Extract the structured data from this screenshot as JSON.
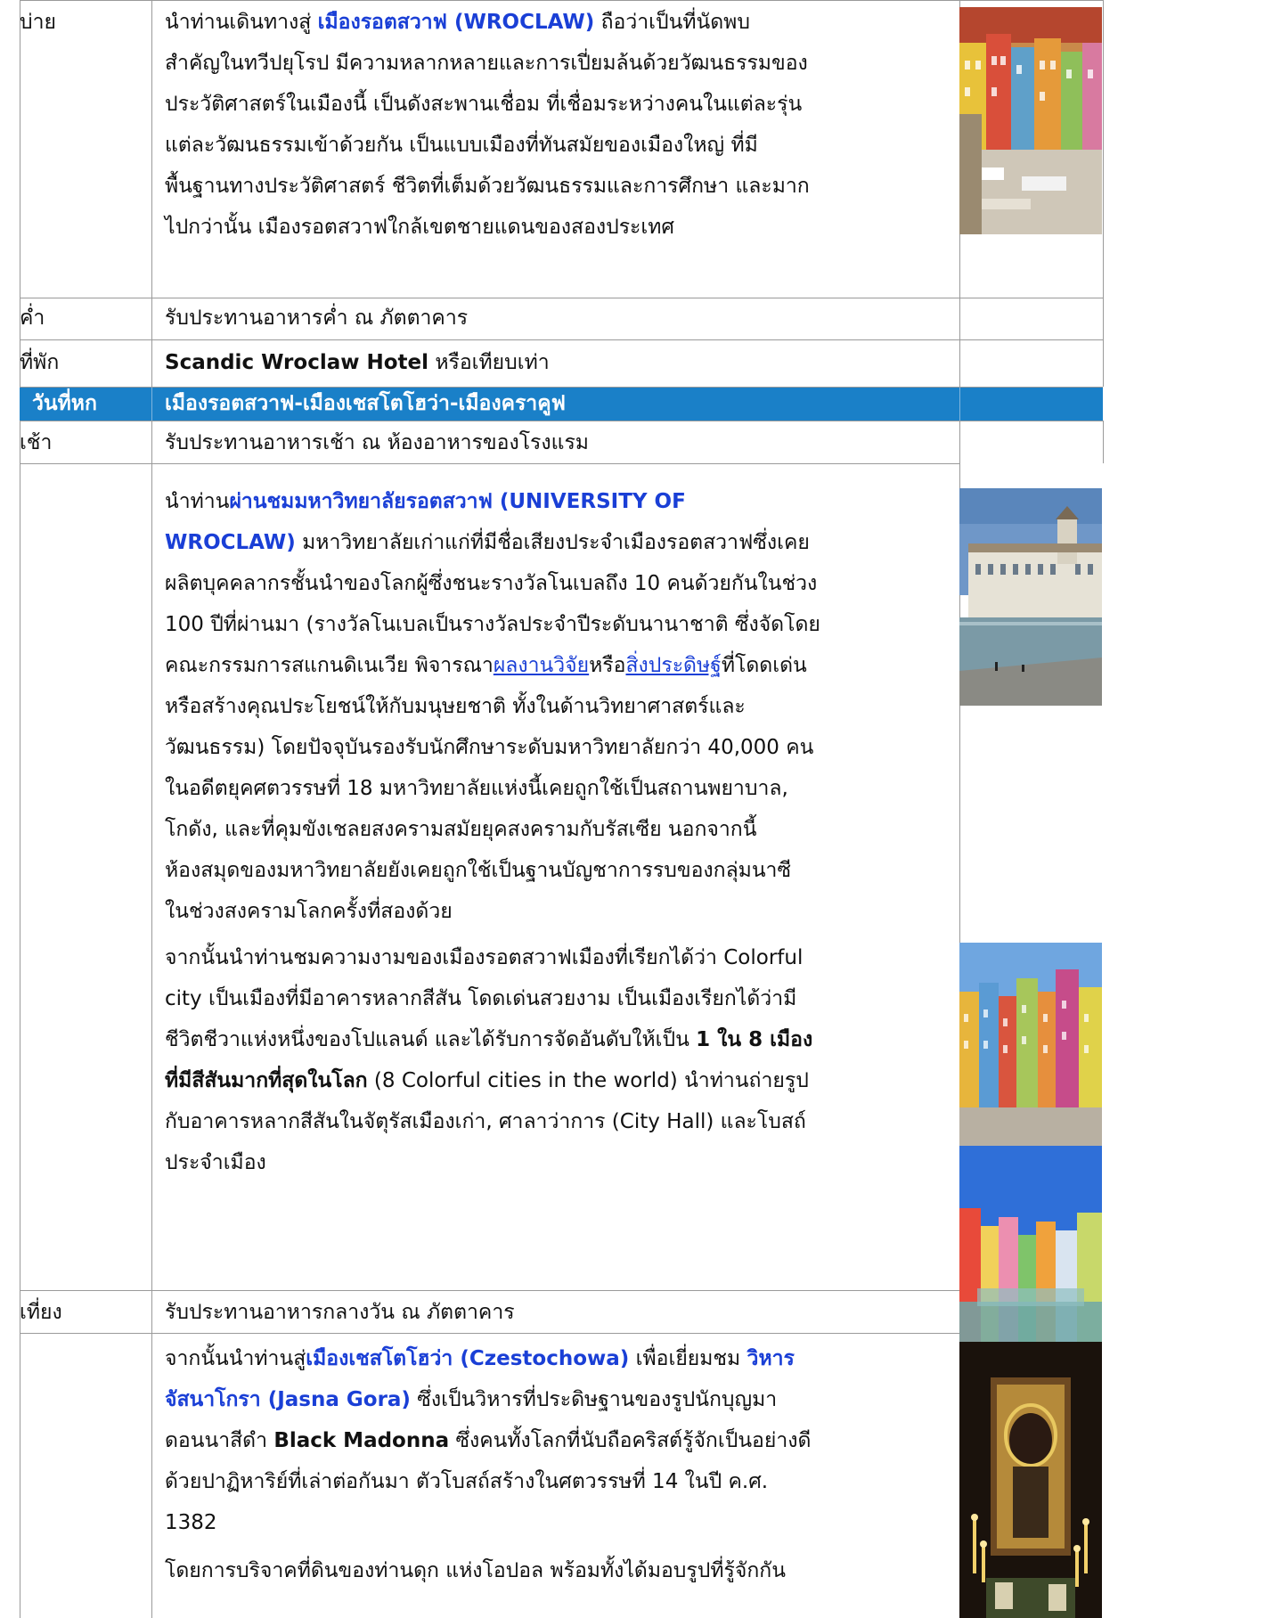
{
  "rows": {
    "afternoon": {
      "label": "บ่าย",
      "lines": [
        {
          "a": "นำท่านเดินทางสู่ ",
          "b": "เมืองรอตสวาฟ    (WROCLAW)",
          "c": " ถือว่าเป็นที่นัดพบ"
        },
        "สำคัญในทวีปยุโรป มีความหลากหลายและการเปี่ยมล้นด้วยวัฒนธรรมของ",
        "ประวัติศาสตร์ในเมืองนี้ เป็นดังสะพานเชื่อม ที่เชื่อมระหว่างคนในแต่ละรุ่น",
        "แต่ละวัฒนธรรมเข้าด้วยกัน เป็นแบบเมืองที่ทันสมัยของเมืองใหญ่ ที่มี",
        "พื้นฐานทางประวัติศาสตร์ ชีวิตที่เต็มด้วยวัฒนธรรมและการศึกษา และมาก",
        "ไปกว่านั้น เมืองรอตสวาฟใกล้เขตชายแดนของสองประเทศ"
      ]
    },
    "dinner": {
      "label": "ค่ำ",
      "text": "รับประทานอาหารค่ำ ณ ภัตตาคาร"
    },
    "hotel": {
      "label": "ที่พัก",
      "name": "Scandic Wroclaw Hotel",
      "suffix": " หรือเทียบเท่า"
    },
    "day": {
      "label": "วันที่หก",
      "title": "เมืองรอตสวาฟ-เมืองเชสโตโฮว่า-เมืองคราคูฟ"
    },
    "breakfast": {
      "label": "เช้า",
      "text": "รับประทานอาหารเช้า ณ ห้องอาหารของโรงแรม"
    },
    "university": {
      "l1a": "นำท่าน",
      "l1b": "ผ่านชมมหาวิทยาลัยรอตสวาฟ (UNIVERSITY OF",
      "l2a": "WROCLAW)",
      "l2b": " มหาวิทยาลัยเก่าแก่ที่มีชื่อเสียงประจำเมืองรอตสวาฟซึ่งเคย",
      "l3": "ผลิตบุคคลากรชั้นนำของโลกผู้ซึ่งชนะรางวัลโนเบลถึง 10 คนด้วยกันในช่วง",
      "l4": "100 ปีที่ผ่านมา (รางวัลโนเบลเป็นรางวัลประจำปีระดับนานาชาติ ซึ่งจัดโดย",
      "l5a": "คณะกรรมการสแกนดิเนเวีย พิจารณา",
      "l5link1": "ผลงานวิจัย",
      "l5b": "หรือ",
      "l5link2": "สิ่งประดิษฐ์",
      "l5c": "ที่โดดเด่น",
      "l6": "หรือสร้างคุณประโยชน์ให้กับมนุษยชาติ ทั้งในด้านวิทยาศาสตร์และ",
      "l7": "วัฒนธรรม)  โดยปัจจุบันรองรับนักศึกษาระดับมหาวิทยาลัยกว่า 40,000 คน",
      "l8": "ในอดีตยุคศตวรรษที่ 18 มหาวิทยาลัยแห่งนี้เคยถูกใช้เป็นสถานพยาบาล,",
      "l9": "โกดัง, และที่คุมขังเชลยสงครามสมัยยุคสงครามกับรัสเซีย นอกจากนี้",
      "l10": "ห้องสมุดของมหาวิทยาลัยยังเคยถูกใช้เป็นฐานบัญชาการรบของกลุ่มนาซี",
      "l11": "ในช่วงสงครามโลกครั้งที่สองด้วย",
      "l12": "จากนั้นนำท่านชมความงามของเมืองรอตสวาฟเมืองที่เรียกได้ว่า Colorful",
      "l13": "city เป็นเมืองที่มีอาคารหลากสีสัน โดดเด่นสวยงาม เป็นเมืองเรียกได้ว่ามี",
      "l14a": "ชีวิตชีวาแห่งหนึ่งของโปแลนด์ และได้รับการจัดอันดับให้เป็น ",
      "l14b": "1 ใน 8 เมือง",
      "l15a": "ที่มีสีสันมากที่สุดในโลก",
      "l15b": " (8 Colorful cities in the world) นำท่านถ่ายรูป",
      "l16": "กับอาคารหลากสีสันในจัตุรัสเมืองเก่า, ศาลาว่าการ (City Hall) และโบสถ์",
      "l17": "ประจำเมือง"
    },
    "lunch": {
      "label": "เที่ยง",
      "text": "รับประทานอาหารกลางวัน ณ ภัตตาคาร"
    },
    "czesto": {
      "l1a": "จากนั้นนำท่านสู่",
      "l1b": "เมืองเชสโตโฮว่า (Czestochowa)",
      "l1c": " เพื่อเยี่ยมชม ",
      "l1d": "วิหาร",
      "l2a": "จัสนาโกรา (Jasna  Gora)",
      "l2b": "  ซึ่งเป็นวิหารที่ประดิษฐานของรูปนักบุญมา",
      "l3a": "ดอนนาสีดำ ",
      "l3b": "Black Madonna",
      "l3c": " ซึ่งคนทั้งโลกที่นับถือคริสต์รู้จักเป็นอย่างดี",
      "l4": "ด้วยปาฏิหาริย์ที่เล่าต่อกันมา ตัวโบสถ์สร้างในศตวรรษที่ 14 ในปี ค.ศ.",
      "l5": "1382",
      "l6": "โดยการบริจาคที่ดินของท่านดุก แห่งโอปอล พร้อมทั้งได้มอบรูปที่รู้จักกัน"
    }
  },
  "colors": {
    "band": "#1a80c8",
    "emphasis": "#1a3fd6",
    "grid": "#9a9a9a"
  },
  "photos": [
    "wroclaw-market-square",
    "university-of-wroclaw",
    "colorful-facades",
    "colorful-square",
    "black-madonna-icon"
  ]
}
